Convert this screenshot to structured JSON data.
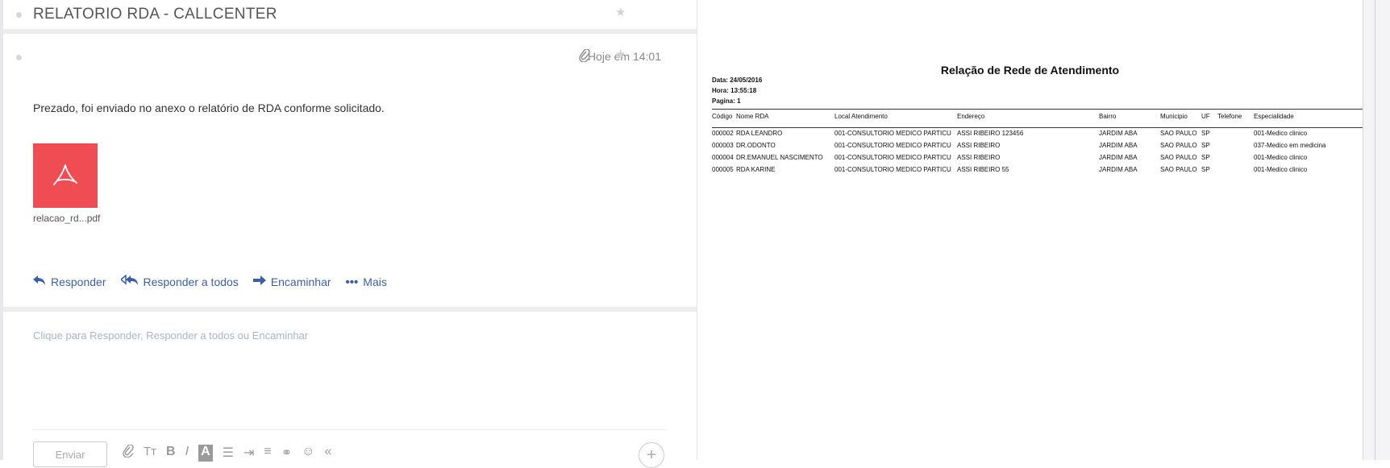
{
  "thread": {
    "title": "RELATORIO RDA - CALLCENTER"
  },
  "message": {
    "date": "Hoje em 14:01",
    "body": "Prezado, foi enviado no anexo o relatório de RDA conforme solicitado.",
    "attachment": {
      "name": "relacao_rd...pdf",
      "icon": "pdf-icon",
      "color": "#ef4c53"
    },
    "actions": [
      {
        "label": "Responder",
        "icon": "reply-icon"
      },
      {
        "label": "Responder a todos",
        "icon": "reply-all-icon"
      },
      {
        "label": "Encaminhar",
        "icon": "forward-icon"
      },
      {
        "label": "Mais",
        "icon": "more-icon"
      }
    ]
  },
  "reply": {
    "placeholder": "Clique para Responder, Responder a todos ou Encaminhar",
    "send_label": "Enviar",
    "toolbar_icons": [
      "attach-icon",
      "text-size-icon",
      "bold-icon",
      "italic-icon",
      "font-color-icon",
      "bullet-list-icon",
      "indent-icon",
      "align-icon",
      "link-icon",
      "emoji-icon",
      "collapse-icon"
    ]
  },
  "report": {
    "title": "Relação de Rede de Atendimento",
    "data": "Data: 24/05/2016",
    "hora": "Hora: 13:55:18",
    "pagina": "Pagina: 1",
    "columns": [
      "Código",
      "Nome RDA",
      "Local Atendimento",
      "Endereço",
      "Bairro",
      "Municipio",
      "UF",
      "Telefone",
      "Especialidade"
    ],
    "rows": [
      [
        "000002",
        "RDA LEANDRO",
        "001-CONSULTORIO MEDICO PARTICU",
        "ASSI RIBEIRO  123456",
        "JARDIM ABA",
        "SAO PAULO",
        "SP",
        "",
        "001-Medico clinico"
      ],
      [
        "000003",
        "DR.ODONTO",
        "001-CONSULTORIO MEDICO PARTICU",
        "ASSI RIBEIRO",
        "JARDIM ABA",
        "SAO PAULO",
        "SP",
        "",
        "037-Medico em medicina"
      ],
      [
        "000004",
        "DR.EMANUEL NASCIMENTO",
        "001-CONSULTORIO MEDICO PARTICU",
        "ASSI RIBEIRO",
        "JARDIM ABA",
        "SAO PAULO",
        "SP",
        "",
        "001-Medico clinico"
      ],
      [
        "000005",
        "RDA KARINE",
        "001-CONSULTORIO MEDICO PARTICU",
        "ASSI RIBEIRO  55",
        "JARDIM ABA",
        "SAO PAULO",
        "SP",
        "",
        "001-Medico clinico"
      ]
    ]
  }
}
